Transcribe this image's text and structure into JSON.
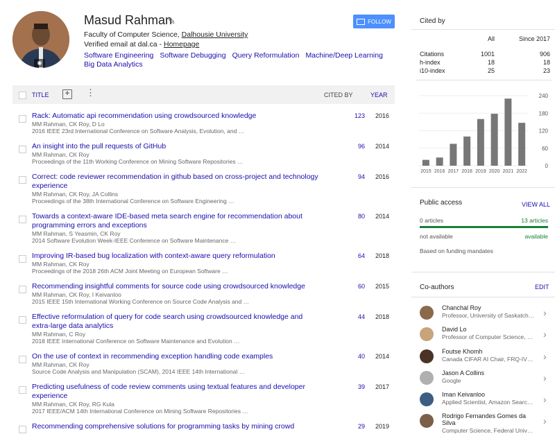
{
  "profile": {
    "name": "Masud Rahman",
    "affiliation_prefix": "Faculty of Computer Science, ",
    "affiliation_link": "Dalhousie University",
    "email_prefix": "Verified email at dal.ca - ",
    "homepage": "Homepage",
    "interests": [
      "Software Engineering",
      "Software Debugging",
      "Query Reformulation",
      "Machine/Deep Learning",
      "Big Data Analytics"
    ],
    "follow_label": "FOLLOW"
  },
  "table": {
    "headers": {
      "title": "TITLE",
      "cited_by": "CITED BY",
      "year": "YEAR"
    },
    "rows": [
      {
        "title": "Rack: Automatic api recommendation using crowdsourced knowledge",
        "authors": "MM Rahman, CK Roy, D Lo",
        "venue": "2016 IEEE 23rd International Conference on Software Analysis, Evolution, and …",
        "cited": "123",
        "year": "2016"
      },
      {
        "title": "An insight into the pull requests of GitHub",
        "authors": "MM Rahman, CK Roy",
        "venue": "Proceedings of the 11th Working Conference on Mining Software Repositories …",
        "cited": "96",
        "year": "2014"
      },
      {
        "title": "Correct: code reviewer recommendation in github based on cross-project and technology experience",
        "authors": "MM Rahman, CK Roy, JA Collins",
        "venue": "Proceedings of the 38th International Conference on Software Engineering …",
        "cited": "94",
        "year": "2016"
      },
      {
        "title": "Towards a context-aware IDE-based meta search engine for recommendation about programming errors and exceptions",
        "authors": "MM Rahman, S Yeasmin, CK Roy",
        "venue": "2014 Software Evolution Week-IEEE Conference on Software Maintenance …",
        "cited": "80",
        "year": "2014"
      },
      {
        "title": "Improving IR-based bug localization with context-aware query reformulation",
        "authors": "MM Rahman, CK Roy",
        "venue": "Proceedings of the 2018 26th ACM Joint Meeting on European Software …",
        "cited": "64",
        "year": "2018"
      },
      {
        "title": "Recommending insightful comments for source code using crowdsourced knowledge",
        "authors": "MM Rahman, CK Roy, I Keivanloo",
        "venue": "2015 IEEE 15th International Working Conference on Source Code Analysis and …",
        "cited": "60",
        "year": "2015"
      },
      {
        "title": "Effective reformulation of query for code search using crowdsourced knowledge and extra-large data analytics",
        "authors": "MM Rahman, C Roy",
        "venue": "2018 IEEE International Conference on Software Maintenance and Evolution …",
        "cited": "44",
        "year": "2018"
      },
      {
        "title": "On the use of context in recommending exception handling code examples",
        "authors": "MM Rahman, CK Roy",
        "venue": "Source Code Analysis and Manipulation (SCAM), 2014 IEEE 14th International …",
        "cited": "40",
        "year": "2014"
      },
      {
        "title": "Predicting usefulness of code review comments using textual features and developer experience",
        "authors": "MM Rahman, CK Roy, RG Kula",
        "venue": "2017 IEEE/ACM 14th International Conference on Mining Software Repositories …",
        "cited": "39",
        "year": "2017"
      },
      {
        "title": "Recommending comprehensive solutions for programming tasks by mining crowd",
        "authors": "",
        "venue": "",
        "cited": "29",
        "year": "2019"
      }
    ]
  },
  "cited_by": {
    "title": "Cited by",
    "col_all": "All",
    "col_since": "Since 2017",
    "stats": [
      {
        "label": "Citations",
        "all": "1001",
        "since": "906"
      },
      {
        "label": "h-index",
        "all": "18",
        "since": "18"
      },
      {
        "label": "i10-index",
        "all": "25",
        "since": "23"
      }
    ]
  },
  "chart_data": {
    "type": "bar",
    "categories": [
      "2015",
      "2016",
      "2017",
      "2018",
      "2019",
      "2020",
      "2021",
      "2022"
    ],
    "values": [
      20,
      28,
      75,
      100,
      160,
      178,
      230,
      147
    ],
    "ylim": [
      0,
      240
    ],
    "yticks": [
      "240",
      "180",
      "120",
      "60",
      "0"
    ],
    "bar_color": "#777777"
  },
  "public_access": {
    "title": "Public access",
    "view_all": "VIEW ALL",
    "left": "0 articles",
    "right": "13 articles",
    "not_available": "not available",
    "available": "available",
    "note": "Based on funding mandates",
    "available_fraction": 1.0,
    "bar_color": "#188038"
  },
  "coauthors": {
    "title": "Co-authors",
    "edit": "EDIT",
    "items": [
      {
        "name": "Chanchal Roy",
        "affil": "Professor, University of Saskatch…",
        "color": "#8a6a4a"
      },
      {
        "name": "David Lo",
        "affil": "Professor of Computer Science, …",
        "color": "#c9a47a"
      },
      {
        "name": "Foutse Khomh",
        "affil": "Canada CIFAR AI Chair, FRQ-IV…",
        "color": "#4a3326"
      },
      {
        "name": "Jason A Collins",
        "affil": "Google",
        "color": "#b0b0b0"
      },
      {
        "name": "Iman Keivanloo",
        "affil": "Applied Scientist, Amazon Searc…",
        "color": "#3b5e82"
      },
      {
        "name": "Rodrigo Fernandes Gomes da Silva",
        "affil": "Computer Science, Federal Univ…",
        "color": "#7a6048"
      }
    ]
  }
}
